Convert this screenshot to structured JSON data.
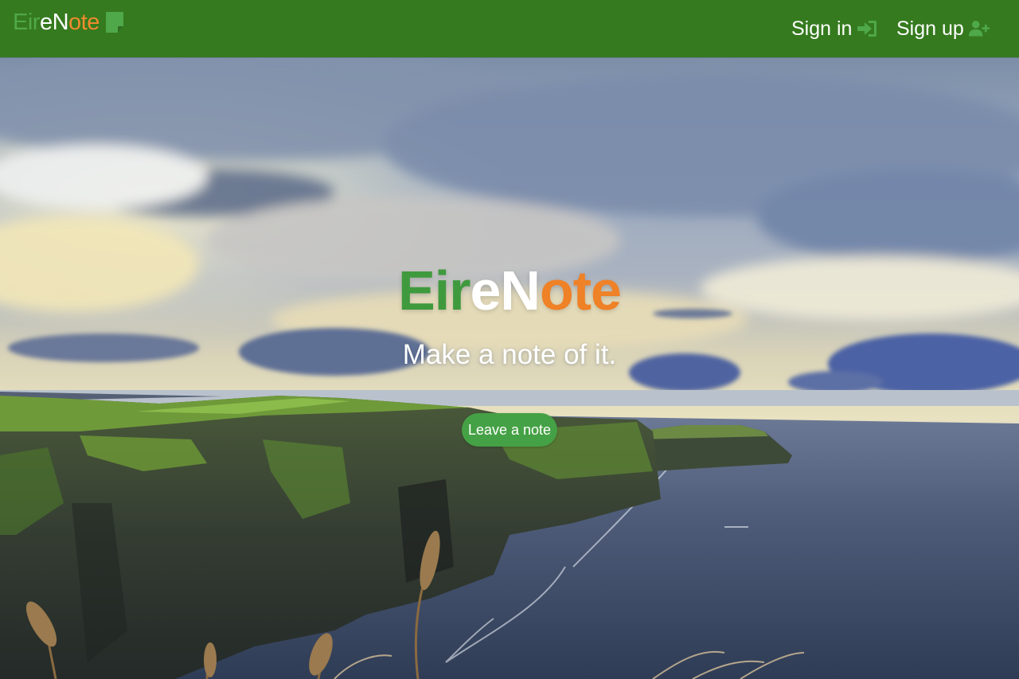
{
  "brand": {
    "part_green": "Eir",
    "part_white": "eN",
    "part_orange": "ote",
    "icon": "sticky-note-icon"
  },
  "nav": {
    "sign_in_label": "Sign in",
    "sign_in_icon": "sign-in-icon",
    "sign_up_label": "Sign up",
    "sign_up_icon": "user-plus-icon"
  },
  "hero": {
    "title_green": "Eir",
    "title_white": "eN",
    "title_orange": "ote",
    "subtitle": "Make a note of it.",
    "cta_label": "Leave a note"
  },
  "colors": {
    "navbar": "#357a1e",
    "irish_green": "#3f9a3e",
    "irish_orange": "#ef8126",
    "button": "#45a145"
  }
}
